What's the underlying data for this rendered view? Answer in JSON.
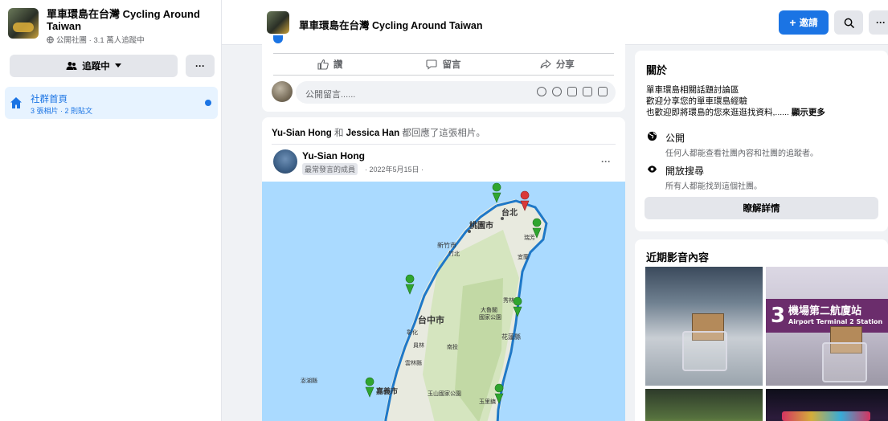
{
  "sidebar": {
    "group_title": "單車環島在台灣 Cycling Around Taiwan",
    "group_meta": "公開社團 · 3.1 萬人追蹤中",
    "follow_label": "追蹤中",
    "more_label": "···",
    "nav_home_label": "社群首頁",
    "nav_home_sub": "3 張相片 · 2 則貼文"
  },
  "topbar": {
    "title": "單車環島在台灣 Cycling Around Taiwan",
    "invite_label": "邀請",
    "more_label": "···"
  },
  "prev_post": {
    "actions": [
      "讚",
      "留言",
      "分享"
    ],
    "comment_placeholder": "公開留言......"
  },
  "post": {
    "reshare_user1": "Yu-Sian Hong",
    "reshare_and": " 和 ",
    "reshare_user2": "Jessica Han",
    "reshare_tail": " 都回應了這張相片。",
    "author": "Yu-Sian Hong",
    "badge": "最常發言的成員",
    "date": "· 2022年5月15日 ·",
    "more_label": "···",
    "map_labels": {
      "taipei": "台北",
      "taoyuan": "桃園市",
      "hsinchu": "新竹市",
      "yilan": "宜蘭",
      "taichung": "台中市",
      "taroko": "大魯閣\n國家公園",
      "hualien": "花蓮縣",
      "chiayi": "嘉義市",
      "yushan": "玉山國家公園",
      "penghu": "澎湖縣",
      "yunlin": "雲林縣",
      "changhua": "彰化",
      "puli": "南投",
      "nantou": "員林",
      "hsinchu2": "竹北",
      "ruifang": "瑞芳",
      "yuli": "玉里鎮",
      "fengbin": "秀林"
    }
  },
  "about": {
    "heading": "關於",
    "desc1": "單車環島相關話題討論區",
    "desc2": "歡迎分享您的單車環島經驗",
    "desc3": "也歡迎即將環島的您來逛逛找資料,...... ",
    "see_more": "顯示更多",
    "public_title": "公開",
    "public_desc": "任何人都能查看社團內容和社團的追蹤者。",
    "search_title": "開放搜尋",
    "search_desc": "所有人都能找到這個社團。",
    "learn_more": "瞭解詳情"
  },
  "media": {
    "heading": "近期影音內容",
    "sign_number": "3",
    "sign_cn": "機場第二航廈站",
    "sign_en": "Airport Terminal 2 Station"
  },
  "colors": {
    "accent": "#1b74e4",
    "route": "#1e78c8",
    "pin_green": "#2fa52f",
    "pin_red": "#d93a3a"
  }
}
